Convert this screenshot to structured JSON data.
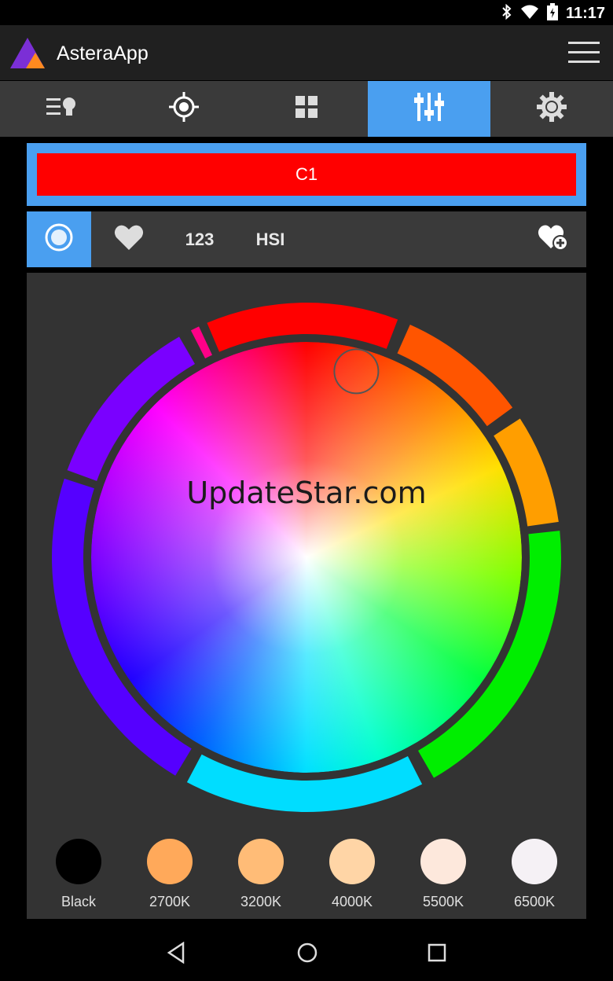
{
  "status_bar": {
    "time": "11:17",
    "icons": [
      "bluetooth-icon",
      "wifi-icon",
      "battery-icon"
    ]
  },
  "app_bar": {
    "title": "AsteraApp",
    "icons": [
      "astera-logo-icon",
      "hamburger-menu-icon"
    ]
  },
  "tabs": [
    {
      "icon": "light-list-icon",
      "active": false
    },
    {
      "icon": "crosshair-icon",
      "active": false
    },
    {
      "icon": "grid-icon",
      "active": false
    },
    {
      "icon": "sliders-icon",
      "active": true
    },
    {
      "icon": "settings-gear-icon",
      "active": false
    }
  ],
  "channel": {
    "label": "C1",
    "color": "#ff0000"
  },
  "modes": {
    "wheel": {
      "icon": "color-wheel-icon",
      "active": true
    },
    "favorites": {
      "icon": "heart-icon"
    },
    "numeric_label": "123",
    "hsi_label": "HSI",
    "add_favorite": {
      "icon": "heart-add-icon"
    }
  },
  "watermark": "UpdateStar.com",
  "selected_hue_deg": 15,
  "swatches": [
    {
      "label": "Black",
      "color": "#000000"
    },
    {
      "label": "2700K",
      "color": "#ffa95a"
    },
    {
      "label": "3200K",
      "color": "#ffbc77"
    },
    {
      "label": "4000K",
      "color": "#ffd5a6"
    },
    {
      "label": "5500K",
      "color": "#fde8dc"
    },
    {
      "label": "6500K",
      "color": "#f5f1f5"
    }
  ],
  "ring_segments": [
    {
      "color": "#ff0000"
    },
    {
      "color": "#ff5500"
    },
    {
      "color": "#ff9e00"
    },
    {
      "color": "#00ee00"
    },
    {
      "color": "#00ddff"
    },
    {
      "color": "#5500ff"
    },
    {
      "color": "#7a00ff"
    },
    {
      "color": "#ff0088"
    }
  ],
  "accent_color": "#4a9ff0",
  "nav": {
    "icons": [
      "back-icon",
      "home-icon",
      "recents-icon"
    ]
  }
}
